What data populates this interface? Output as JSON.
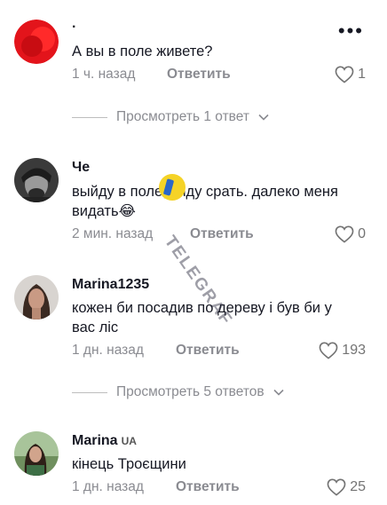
{
  "comments": [
    {
      "username": ".",
      "text": "А вы в поле живете?",
      "time": "1 ч. назад",
      "reply_label": "Ответить",
      "likes": "1"
    },
    {
      "username": "Че",
      "text": "выйду в поле, сяду срать. далеко меня видать😂",
      "time": "2 мин. назад",
      "reply_label": "Ответить",
      "likes": "0"
    },
    {
      "username": "Marina1235",
      "text": "кожен би посадив по дереву і був би у вас ліс",
      "time": "1 дн. назад",
      "reply_label": "Ответить",
      "likes": "193"
    },
    {
      "username": "Marina",
      "country_badge": "UA",
      "text": "кінець Троєщини",
      "time": "1 дн. назад",
      "reply_label": "Ответить",
      "likes": "25"
    }
  ],
  "view_replies": [
    {
      "label": "Просмотреть 1 ответ"
    },
    {
      "label": "Просмотреть 5 ответов"
    }
  ],
  "more_menu": "•••",
  "watermark": {
    "text": "TELEGRAF",
    "logo_color": "#f5d327"
  },
  "colors": {
    "avatar_red": "#e3141b",
    "meta_gray": "#8a8b91",
    "text": "#161823"
  }
}
